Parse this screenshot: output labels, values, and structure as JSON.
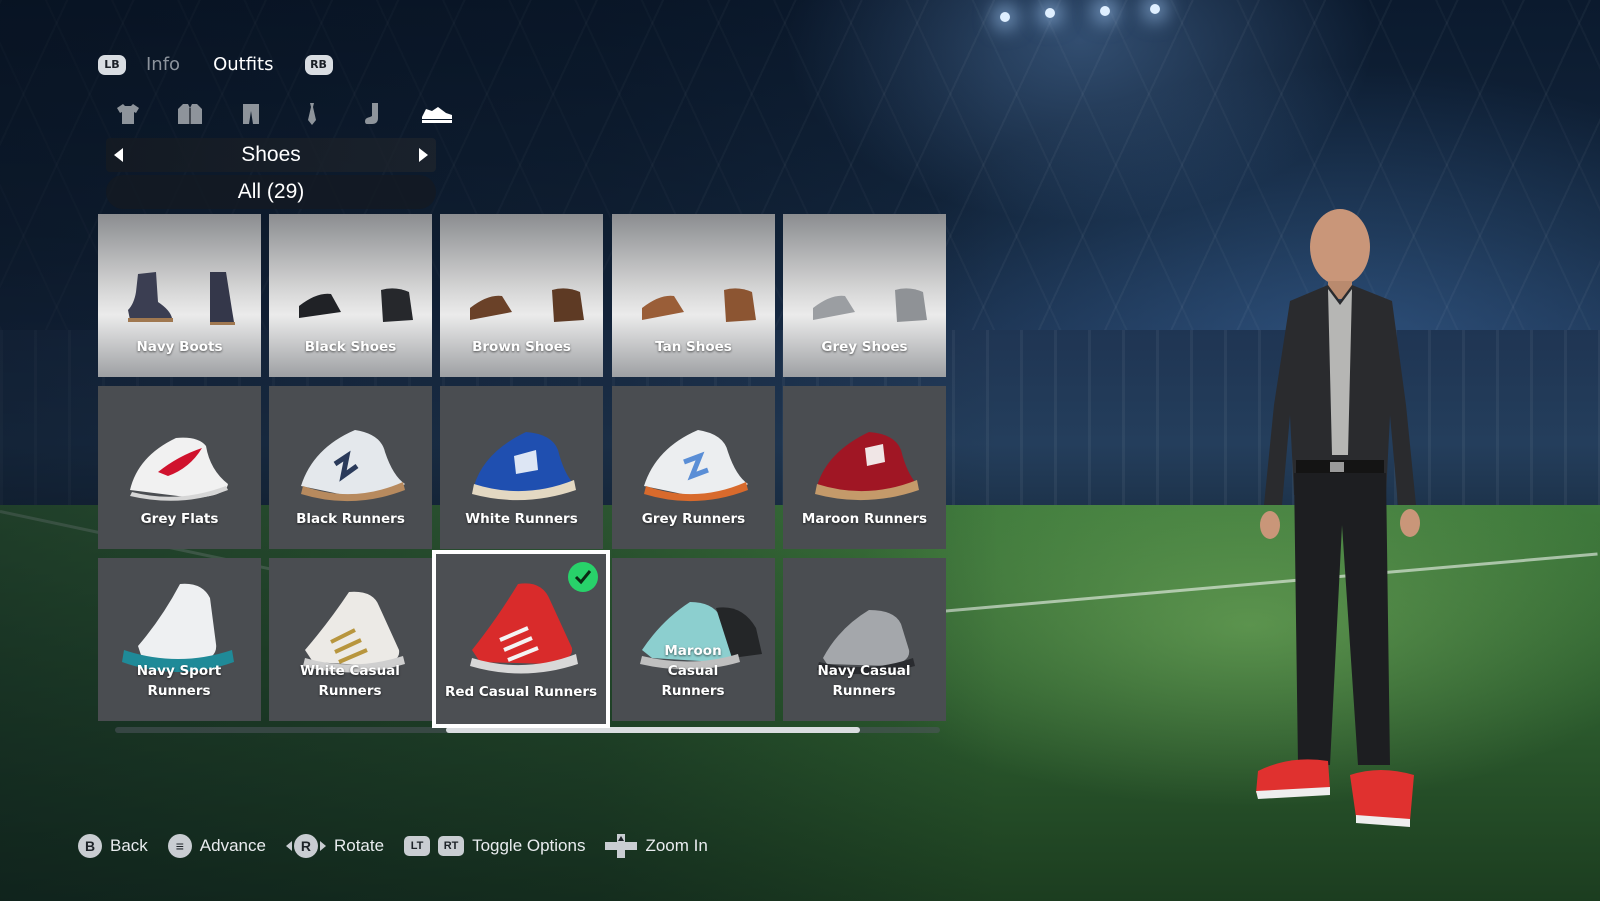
{
  "tabs": {
    "prev_button": "LB",
    "items": [
      "Info",
      "Outfits"
    ],
    "active": "Outfits",
    "next_button": "RB"
  },
  "category_icons": [
    "shirt-icon",
    "jacket-icon",
    "trousers-icon",
    "tie-icon",
    "sock-icon",
    "shoe-icon"
  ],
  "selector": {
    "title": "Shoes",
    "filter": "All (29)"
  },
  "items": [
    {
      "label": "Navy Boots",
      "style": "formal"
    },
    {
      "label": "Black Shoes",
      "style": "formal"
    },
    {
      "label": "Brown Shoes",
      "style": "formal"
    },
    {
      "label": "Tan Shoes",
      "style": "formal"
    },
    {
      "label": "Grey Shoes",
      "style": "formal"
    },
    {
      "label": "Grey Flats",
      "style": "runner"
    },
    {
      "label": "Black Runners",
      "style": "runner"
    },
    {
      "label": "White Runners",
      "style": "runner"
    },
    {
      "label": "Grey Runners",
      "style": "runner"
    },
    {
      "label": "Maroon Runners",
      "style": "runner"
    },
    {
      "label": "Navy Sport Runners",
      "style": "runner"
    },
    {
      "label": "White Casual Runners",
      "style": "runner"
    },
    {
      "label": "Red Casual Runners",
      "style": "runner",
      "selected": true
    },
    {
      "label": "Maroon Casual Runners",
      "style": "runner"
    },
    {
      "label": "Navy Casual Runners",
      "style": "runner"
    }
  ],
  "footer": {
    "back": {
      "button": "B",
      "label": "Back"
    },
    "advance": {
      "button": "≡",
      "label": "Advance"
    },
    "rotate": {
      "button": "R",
      "label": "Rotate"
    },
    "toggle": {
      "buttons": [
        "LT",
        "RT"
      ],
      "label": "Toggle Options"
    },
    "zoom": {
      "label": "Zoom In"
    }
  },
  "colors": {
    "selected_check": "#28d26a",
    "card_bg": "#4a4d51"
  }
}
